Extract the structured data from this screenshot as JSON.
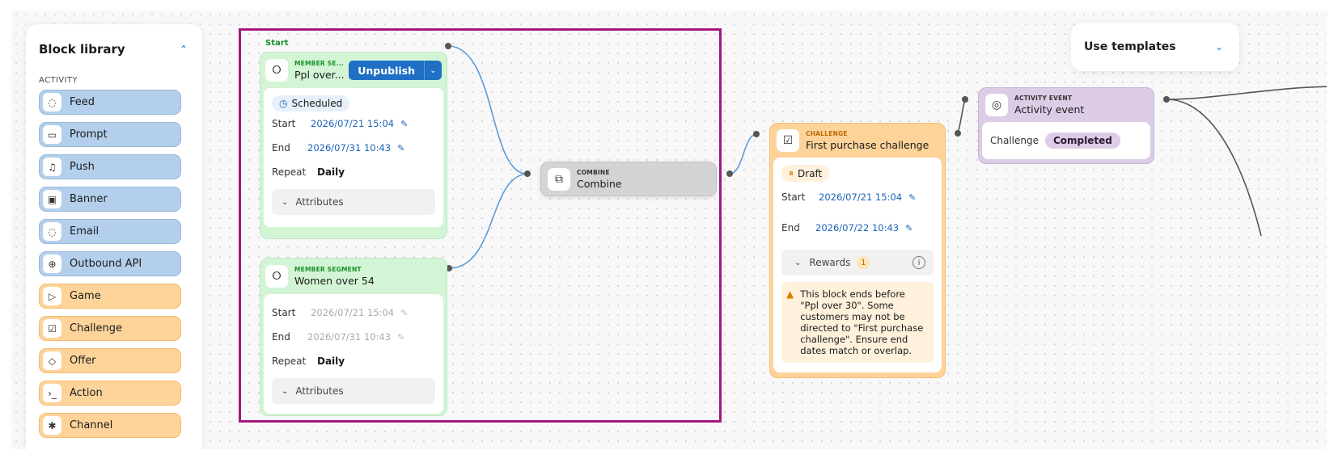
{
  "library": {
    "title": "Block library",
    "section": "ACTIVITY",
    "items": [
      {
        "label": "Feed",
        "icon": "chat-bubble-icon",
        "glyph": "◌"
      },
      {
        "label": "Prompt",
        "icon": "message-square-icon",
        "glyph": "▭"
      },
      {
        "label": "Push",
        "icon": "bell-icon",
        "glyph": "♫"
      },
      {
        "label": "Banner",
        "icon": "image-icon",
        "glyph": "▣"
      },
      {
        "label": "Email",
        "icon": "chat-bubble-icon",
        "glyph": "◌"
      },
      {
        "label": "Outbound API",
        "icon": "globe-icon",
        "glyph": "⊕"
      },
      {
        "label": "Game",
        "icon": "play-icon",
        "glyph": "▷"
      },
      {
        "label": "Challenge",
        "icon": "checklist-icon",
        "glyph": "☑"
      },
      {
        "label": "Offer",
        "icon": "tag-icon",
        "glyph": "◇"
      },
      {
        "label": "Action",
        "icon": "terminal-icon",
        "glyph": "›_"
      },
      {
        "label": "Channel",
        "icon": "asterisk-icon",
        "glyph": "✱"
      }
    ]
  },
  "templates": {
    "label": "Use templates"
  },
  "canvas": {
    "start_label": "Start",
    "node1": {
      "category": "MEMBER SE...",
      "title": "Ppl over...",
      "publish_label": "Unpublish",
      "status": "Scheduled",
      "start_label": "Start",
      "start_value": "2026/07/21 15:04",
      "end_label": "End",
      "end_value": "2026/07/31 10:43",
      "repeat_label": "Repeat",
      "repeat_value": "Daily",
      "attributes_label": "Attributes"
    },
    "node2": {
      "category": "MEMBER SEGMENT",
      "title": "Women over 54",
      "start_label": "Start",
      "start_value": "2026/07/21 15:04",
      "end_label": "End",
      "end_value": "2026/07/31 10:43",
      "repeat_label": "Repeat",
      "repeat_value": "Daily",
      "attributes_label": "Attributes"
    },
    "combine": {
      "category": "COMBINE",
      "title": "Combine"
    },
    "challenge": {
      "category": "CHALLENGE",
      "title": "First purchase challenge",
      "status": "Draft",
      "start_label": "Start",
      "start_value": "2026/07/21 15:04",
      "end_label": "End",
      "end_value": "2026/07/22 10:43",
      "rewards_label": "Rewards",
      "rewards_count": "1",
      "warning": "This block ends before \"Ppl over 30\". Some customers may not be directed to \"First purchase challenge\". Ensure end dates match or overlap."
    },
    "activity": {
      "category": "ACTIVITY EVENT",
      "title": "Activity event",
      "field_label": "Challenge",
      "field_value": "Completed"
    }
  },
  "colors": {
    "selection": "#a4177f",
    "wire": "#5b9bd5",
    "accent": "#1f6fc4"
  }
}
